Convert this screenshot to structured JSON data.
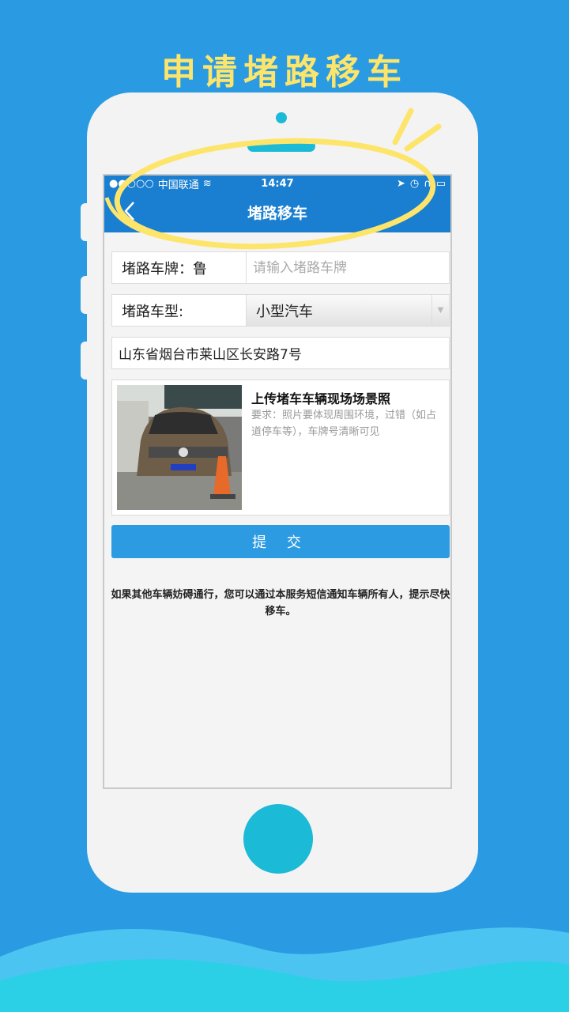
{
  "headline": "申请堵路移车",
  "status_bar": {
    "carrier": "中国联通",
    "time": "14:47"
  },
  "nav": {
    "title": "堵路移车",
    "back_icon": "chevron-left-icon"
  },
  "form": {
    "plate": {
      "label": "堵路车牌：鲁",
      "value": "",
      "placeholder": "请输入堵路车牌"
    },
    "vehicle_type": {
      "label": "堵路车型:",
      "selected": "小型汽车"
    },
    "address": "山东省烟台市莱山区长安路7号"
  },
  "upload": {
    "title": "上传堵车车辆现场场景照",
    "requirement": "要求：照片要体现周围环境，过错（如占道停车等），车牌号清晰可见"
  },
  "submit_label": "提 交",
  "notice": "如果其他车辆妨碍通行，您可以通过本服务短信通知车辆所有人，提示尽快移车。",
  "colors": {
    "background": "#2a9be2",
    "headline": "#fde56b",
    "nav_bar": "#1a7fd0",
    "button": "#2d9be2",
    "accent": "#1bbad6"
  }
}
